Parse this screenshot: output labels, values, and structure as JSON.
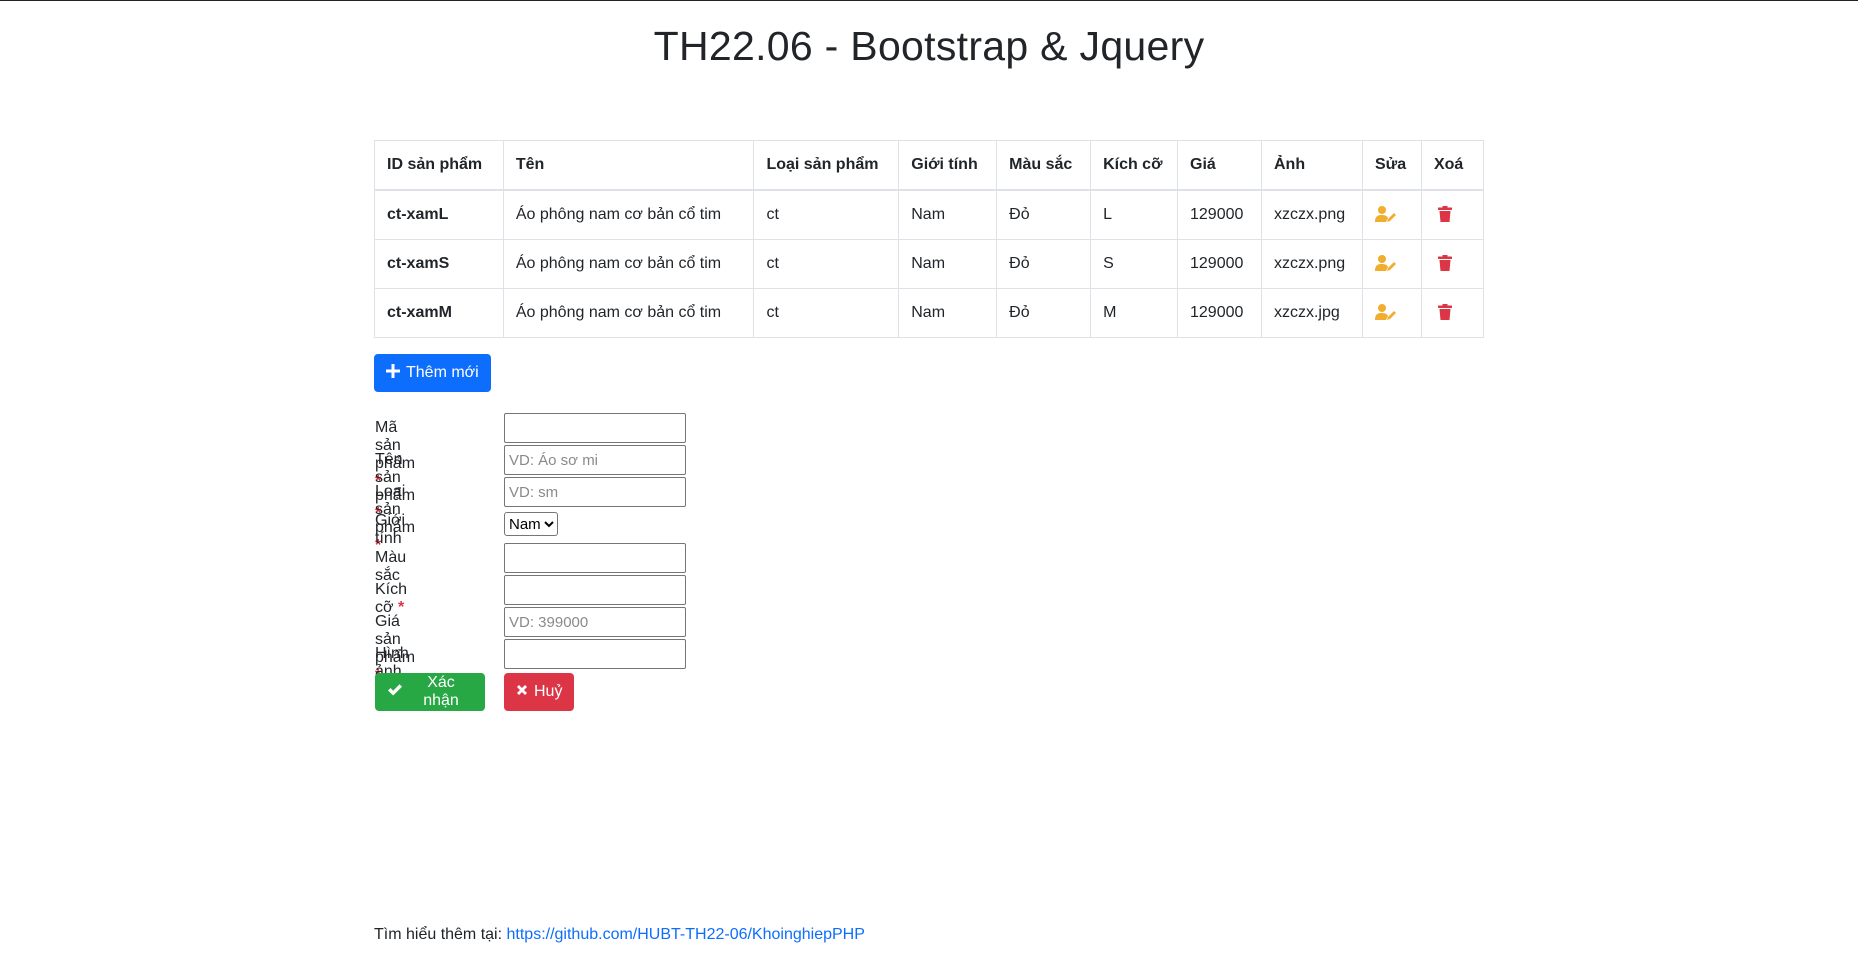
{
  "page": {
    "title": "TH22.06 - Bootstrap & Jquery"
  },
  "table": {
    "headers": [
      "ID sản phẩm",
      "Tên",
      "Loại sản phẩm",
      "Giới tính",
      "Màu sắc",
      "Kích cỡ",
      "Giá",
      "Ảnh",
      "Sửa",
      "Xoá"
    ],
    "rows": [
      {
        "id": "ct-xamL",
        "name": "Áo phông nam cơ bản cổ tim",
        "type": "ct",
        "gender": "Nam",
        "color": "Đỏ",
        "size": "L",
        "price": "129000",
        "image": "xzczx.png"
      },
      {
        "id": "ct-xamS",
        "name": "Áo phông nam cơ bản cổ tim",
        "type": "ct",
        "gender": "Nam",
        "color": "Đỏ",
        "size": "S",
        "price": "129000",
        "image": "xzczx.png"
      },
      {
        "id": "ct-xamM",
        "name": "Áo phông nam cơ bản cổ tim",
        "type": "ct",
        "gender": "Nam",
        "color": "Đỏ",
        "size": "M",
        "price": "129000",
        "image": "xzczx.jpg"
      }
    ],
    "icons": {
      "edit": "user-edit-icon",
      "delete": "trash-icon"
    },
    "edit_icon_color": "#f0ad2e",
    "delete_icon_color": "#dc3545"
  },
  "add_button": {
    "label": "Thêm mới",
    "icon": "plus-icon"
  },
  "form": {
    "fields": {
      "code": {
        "label": "Mã sản phẩm",
        "value": "",
        "placeholder": "",
        "required": true
      },
      "name": {
        "label": "Tên sản phẩm",
        "value": "",
        "placeholder": "VD: Áo sơ mi",
        "required": true
      },
      "type": {
        "label": "Loại sản phẩm",
        "value": "",
        "placeholder": "VD: sm",
        "required": true
      },
      "gender": {
        "label": "Giới tính",
        "selected": "Nam",
        "required": false
      },
      "color": {
        "label": "Màu sắc",
        "value": "",
        "placeholder": "",
        "required": false
      },
      "size": {
        "label": "Kích cỡ",
        "value": "",
        "placeholder": "",
        "required": true
      },
      "price": {
        "label": "Giá sản phẩm",
        "value": "",
        "placeholder": "VD: 399000",
        "required": true
      },
      "image": {
        "label": "Hình ảnh",
        "value": "",
        "placeholder": "",
        "required": false
      }
    },
    "required_marker": "*",
    "confirm_label": "Xác nhận",
    "cancel_label": "Huỷ"
  },
  "footer": {
    "text": "Tìm hiểu thêm tại:",
    "link": "https://github.com/HUBT-TH22-06/KhoinghiepPHP"
  },
  "colors": {
    "primary": "#0d6efd",
    "success": "#28a745",
    "danger": "#dc3545"
  }
}
